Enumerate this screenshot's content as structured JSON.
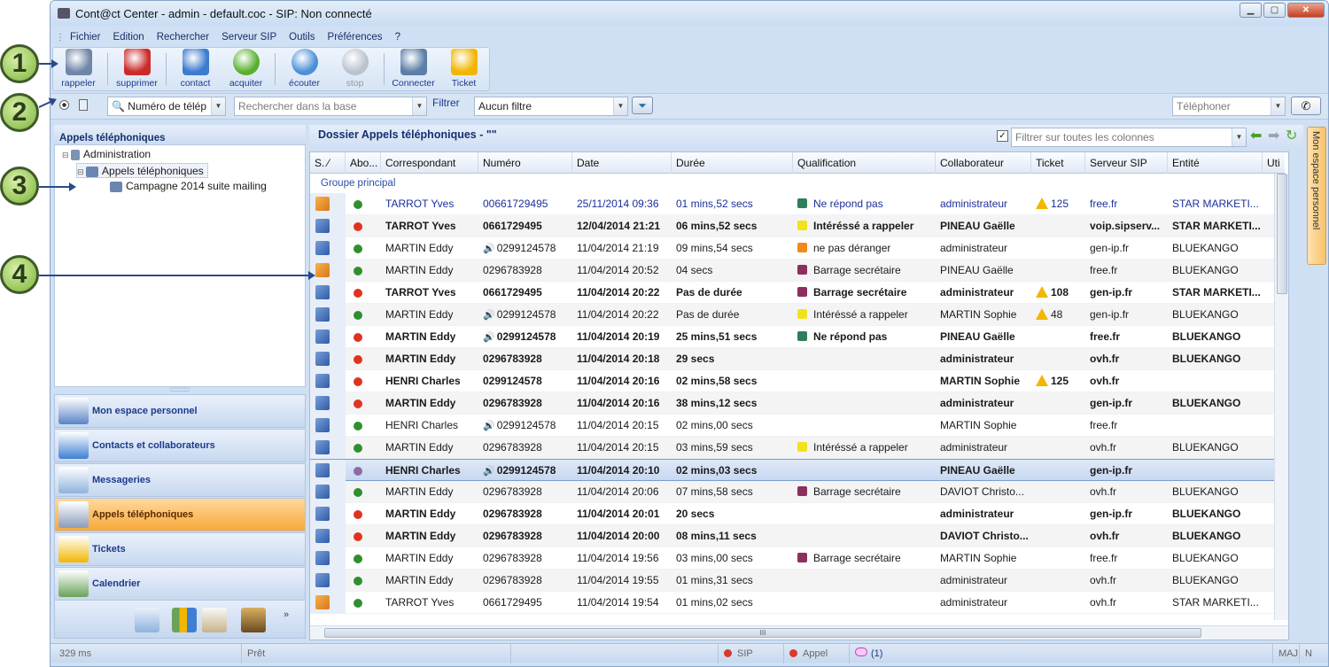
{
  "window": {
    "title": "Cont@ct Center - admin - default.coc - SIP: Non connecté"
  },
  "menu": [
    "Fichier",
    "Edition",
    "Rechercher",
    "Serveur SIP",
    "Outils",
    "Préférences",
    "?"
  ],
  "toolbar": [
    {
      "label": "rappeler",
      "icon": "phone-list-icon",
      "enabled": true,
      "color": "#6f86a8"
    },
    {
      "label": "supprimer",
      "icon": "delete-icon",
      "enabled": true,
      "color": "#cc2b2b"
    },
    {
      "label": "contact",
      "icon": "contact-icon",
      "enabled": true,
      "color": "#3d7bd0"
    },
    {
      "label": "acquiter",
      "icon": "check-icon",
      "enabled": true,
      "color": "#59b02f"
    },
    {
      "label": "écouter",
      "icon": "play-icon",
      "enabled": true,
      "color": "#4b8fd8"
    },
    {
      "label": "stop",
      "icon": "stop-icon",
      "enabled": false,
      "color": "#b9c2cd"
    },
    {
      "label": "Connecter",
      "icon": "connect-icon",
      "enabled": true,
      "color": "#5d7ea8"
    },
    {
      "label": "Ticket",
      "icon": "warning-icon",
      "enabled": true,
      "color": "#f2b600"
    }
  ],
  "filterbar": {
    "search_field": "Numéro de télép",
    "search_placeholder": "Rechercher dans la base",
    "filter_label": "Filtrer",
    "filter_value": "Aucun filtre",
    "phone_placeholder": "Téléphoner"
  },
  "tree": {
    "header": "Appels téléphoniques",
    "nodes": [
      "Administration",
      "Appels téléphoniques",
      "Campagne 2014 suite mailing"
    ]
  },
  "nav": [
    {
      "label": "Mon espace personnel",
      "icon": "computer-icon",
      "active": false,
      "color": "#5a84c8"
    },
    {
      "label": "Contacts et collaborateurs",
      "icon": "user-icon",
      "active": false,
      "color": "#3f7fd2"
    },
    {
      "label": "Messageries",
      "icon": "mail-icon",
      "active": false,
      "color": "#8fb3de"
    },
    {
      "label": "Appels téléphoniques",
      "icon": "phone-icon",
      "active": true,
      "color": "#8a9cb8"
    },
    {
      "label": "Tickets",
      "icon": "warning-icon",
      "active": false,
      "color": "#f2b600"
    },
    {
      "label": "Calendrier",
      "icon": "calendar-icon",
      "active": false,
      "color": "#6aa25a"
    }
  ],
  "main": {
    "title": "Dossier Appels téléphoniques - \"\"",
    "column_filter_placeholder": "Filtrer sur toutes les colonnes",
    "columns": [
      "S. ⁄",
      "Abo...",
      "Correspondant",
      "Numéro",
      "Date",
      "Durée",
      "Qualification",
      "Collaborateur",
      "Ticket",
      "Serveur SIP",
      "Entité",
      "Uti"
    ],
    "group_label": "Groupe principal",
    "colors": {
      "green": "#2f8f2f",
      "red": "#e0331f",
      "purple": "#8e6aa8",
      "q_green": "#2e7d5b",
      "q_yellow": "#f2e21a",
      "q_orange": "#f08a1c",
      "q_purple": "#8c2f5e"
    }
  },
  "rows": [
    {
      "dir": "out",
      "abo": "green",
      "name": "TARROT Yves",
      "spk": "",
      "num": "00661729495",
      "date": "25/11/2014 09:36",
      "dur": "01 mins,52 secs",
      "qcolor": "q_green",
      "qual": "Ne répond pas",
      "collab": "administrateur",
      "ticket": "125",
      "sip": "free.fr",
      "ent": "STAR MARKETI...",
      "style": "blue"
    },
    {
      "dir": "in",
      "abo": "red",
      "name": "TARROT Yves",
      "spk": "",
      "num": "0661729495",
      "date": "12/04/2014 21:21",
      "dur": "06 mins,52 secs",
      "qcolor": "q_yellow",
      "qual": "Intéréssé a rappeler",
      "collab": "PINEAU Gaëlle",
      "ticket": "",
      "sip": "voip.sipserv...",
      "ent": "STAR MARKETI...",
      "style": "bold"
    },
    {
      "dir": "in",
      "abo": "green",
      "name": "MARTIN Eddy",
      "spk": "o",
      "num": "0299124578",
      "date": "11/04/2014 21:19",
      "dur": "09 mins,54 secs",
      "qcolor": "q_orange",
      "qual": "ne pas déranger",
      "collab": "administrateur",
      "ticket": "",
      "sip": "gen-ip.fr",
      "ent": "BLUEKANGO",
      "style": ""
    },
    {
      "dir": "out",
      "abo": "green",
      "name": "MARTIN Eddy",
      "spk": "",
      "num": "0296783928",
      "date": "11/04/2014 20:52",
      "dur": "04 secs",
      "qcolor": "q_purple",
      "qual": "Barrage secrétaire",
      "collab": "PINEAU Gaëlle",
      "ticket": "",
      "sip": "free.fr",
      "ent": "BLUEKANGO",
      "style": ""
    },
    {
      "dir": "in",
      "abo": "red",
      "name": "TARROT Yves",
      "spk": "",
      "num": "0661729495",
      "date": "11/04/2014 20:22",
      "dur": "Pas de durée",
      "qcolor": "q_purple",
      "qual": "Barrage secrétaire",
      "collab": "administrateur",
      "ticket": "108",
      "sip": "gen-ip.fr",
      "ent": "STAR MARKETI...",
      "style": "bold"
    },
    {
      "dir": "in",
      "abo": "green",
      "name": "MARTIN Eddy",
      "spk": "b",
      "num": "0299124578",
      "date": "11/04/2014 20:22",
      "dur": "Pas de durée",
      "qcolor": "q_yellow",
      "qual": "Intéréssé a rappeler",
      "collab": "MARTIN Sophie",
      "ticket": "48",
      "sip": "gen-ip.fr",
      "ent": "BLUEKANGO",
      "style": ""
    },
    {
      "dir": "in",
      "abo": "red",
      "name": "MARTIN Eddy",
      "spk": "o",
      "num": "0299124578",
      "date": "11/04/2014 20:19",
      "dur": "25 mins,51 secs",
      "qcolor": "q_green",
      "qual": "Ne répond pas",
      "collab": "PINEAU Gaëlle",
      "ticket": "",
      "sip": "free.fr",
      "ent": "BLUEKANGO",
      "style": "bold"
    },
    {
      "dir": "in",
      "abo": "red",
      "name": "MARTIN Eddy",
      "spk": "",
      "num": "0296783928",
      "date": "11/04/2014 20:18",
      "dur": "29 secs",
      "qcolor": "",
      "qual": "",
      "collab": "administrateur",
      "ticket": "",
      "sip": "ovh.fr",
      "ent": "BLUEKANGO",
      "style": "bold"
    },
    {
      "dir": "in",
      "abo": "red",
      "name": "HENRI Charles",
      "spk": "",
      "num": "0299124578",
      "date": "11/04/2014 20:16",
      "dur": "02 mins,58 secs",
      "qcolor": "",
      "qual": "",
      "collab": "MARTIN Sophie",
      "ticket": "125",
      "sip": "ovh.fr",
      "ent": "",
      "style": "bold"
    },
    {
      "dir": "in",
      "abo": "red",
      "name": "MARTIN Eddy",
      "spk": "",
      "num": "0296783928",
      "date": "11/04/2014 20:16",
      "dur": "38 mins,12 secs",
      "qcolor": "",
      "qual": "",
      "collab": "administrateur",
      "ticket": "",
      "sip": "gen-ip.fr",
      "ent": "BLUEKANGO",
      "style": "bold"
    },
    {
      "dir": "in",
      "abo": "green",
      "name": "HENRI Charles",
      "spk": "b",
      "num": "0299124578",
      "date": "11/04/2014 20:15",
      "dur": "02 mins,00 secs",
      "qcolor": "",
      "qual": "",
      "collab": "MARTIN Sophie",
      "ticket": "",
      "sip": "free.fr",
      "ent": "",
      "style": ""
    },
    {
      "dir": "in",
      "abo": "green",
      "name": "MARTIN Eddy",
      "spk": "",
      "num": "0296783928",
      "date": "11/04/2014 20:15",
      "dur": "03 mins,59 secs",
      "qcolor": "q_yellow",
      "qual": "Intéréssé a rappeler",
      "collab": "administrateur",
      "ticket": "",
      "sip": "ovh.fr",
      "ent": "BLUEKANGO",
      "style": ""
    },
    {
      "dir": "in",
      "abo": "purple",
      "name": "HENRI Charles",
      "spk": "b",
      "num": "0299124578",
      "date": "11/04/2014 20:10",
      "dur": "02 mins,03 secs",
      "qcolor": "",
      "qual": "",
      "collab": "PINEAU Gaëlle",
      "ticket": "",
      "sip": "gen-ip.fr",
      "ent": "",
      "style": "bold sel"
    },
    {
      "dir": "in",
      "abo": "green",
      "name": "MARTIN Eddy",
      "spk": "",
      "num": "0296783928",
      "date": "11/04/2014 20:06",
      "dur": "07 mins,58 secs",
      "qcolor": "q_purple",
      "qual": "Barrage secrétaire",
      "collab": "DAVIOT Christo...",
      "ticket": "",
      "sip": "ovh.fr",
      "ent": "BLUEKANGO",
      "style": ""
    },
    {
      "dir": "in",
      "abo": "red",
      "name": "MARTIN Eddy",
      "spk": "",
      "num": "0296783928",
      "date": "11/04/2014 20:01",
      "dur": "20 secs",
      "qcolor": "",
      "qual": "",
      "collab": "administrateur",
      "ticket": "",
      "sip": "gen-ip.fr",
      "ent": "BLUEKANGO",
      "style": "bold"
    },
    {
      "dir": "in",
      "abo": "red",
      "name": "MARTIN Eddy",
      "spk": "",
      "num": "0296783928",
      "date": "11/04/2014 20:00",
      "dur": "08 mins,11 secs",
      "qcolor": "",
      "qual": "",
      "collab": "DAVIOT Christo...",
      "ticket": "",
      "sip": "ovh.fr",
      "ent": "BLUEKANGO",
      "style": "bold"
    },
    {
      "dir": "in",
      "abo": "green",
      "name": "MARTIN Eddy",
      "spk": "",
      "num": "0296783928",
      "date": "11/04/2014 19:56",
      "dur": "03 mins,00 secs",
      "qcolor": "q_purple",
      "qual": "Barrage secrétaire",
      "collab": "MARTIN Sophie",
      "ticket": "",
      "sip": "free.fr",
      "ent": "BLUEKANGO",
      "style": ""
    },
    {
      "dir": "in",
      "abo": "green",
      "name": "MARTIN Eddy",
      "spk": "",
      "num": "0296783928",
      "date": "11/04/2014 19:55",
      "dur": "01 mins,31 secs",
      "qcolor": "",
      "qual": "",
      "collab": "administrateur",
      "ticket": "",
      "sip": "ovh.fr",
      "ent": "BLUEKANGO",
      "style": ""
    },
    {
      "dir": "out",
      "abo": "green",
      "name": "TARROT Yves",
      "spk": "",
      "num": "0661729495",
      "date": "11/04/2014 19:54",
      "dur": "01 mins,02 secs",
      "qcolor": "",
      "qual": "",
      "collab": "administrateur",
      "ticket": "",
      "sip": "ovh.fr",
      "ent": "STAR MARKETI...",
      "style": ""
    }
  ],
  "sidetab": "Mon espace personnel",
  "status": {
    "time": "329 ms",
    "state": "Prêt",
    "sip": "SIP",
    "appel": "Appel",
    "msg": "(1)",
    "caps": "MAJ",
    "num": "N"
  },
  "callouts": [
    "1",
    "2",
    "3",
    "4"
  ]
}
